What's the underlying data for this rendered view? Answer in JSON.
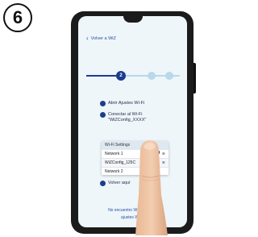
{
  "step": {
    "number": "6"
  },
  "app": {
    "back_label": "Volver a WiZ",
    "stepper": {
      "active_step": "2"
    }
  },
  "instructions": [
    {
      "number": "1",
      "text": "Abrir Ajustes Wi-Fi"
    },
    {
      "number": "2",
      "text_line1": "Conectar al Wi-Fi",
      "text_line2": "\"WiZConfig_XXXX\""
    },
    {
      "number": "3",
      "text": "Volver aquí"
    }
  ],
  "wifi_settings": {
    "title": "Wi-Fi Settings",
    "networks": [
      {
        "name": "Network 1"
      },
      {
        "name": "WiZConfig_125C"
      },
      {
        "name": "Network 2"
      }
    ]
  },
  "footer": {
    "line1": "No encuentro WiZConfig_X",
    "line2": "ajustes Wi-Fi"
  },
  "colors": {
    "accent": "#1c3c8f",
    "screen_bg": "#eef6fa",
    "link": "#2a4fa6"
  }
}
